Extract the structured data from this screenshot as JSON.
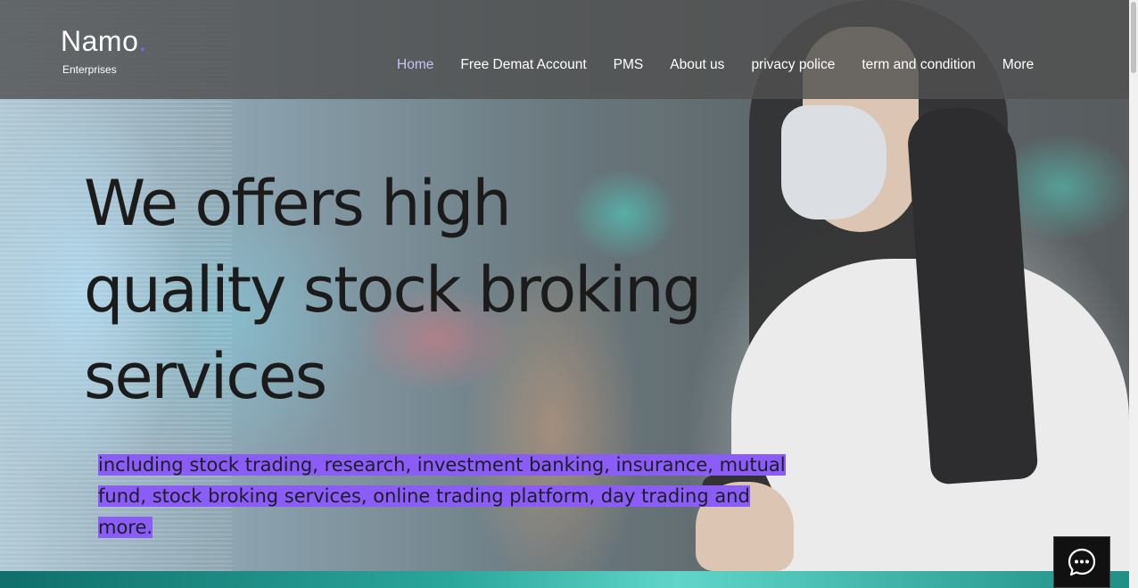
{
  "header": {
    "logo_name": "Namo",
    "logo_dot": ".",
    "logo_sub": "Enterprises"
  },
  "nav": {
    "items": [
      {
        "label": "Home",
        "active": true
      },
      {
        "label": "Free Demat Account",
        "active": false
      },
      {
        "label": "PMS",
        "active": false
      },
      {
        "label": "About us",
        "active": false
      },
      {
        "label": "privacy police",
        "active": false
      },
      {
        "label": "term and condition",
        "active": false
      },
      {
        "label": "More",
        "active": false
      }
    ]
  },
  "hero": {
    "headline_line1": "We offers high",
    "headline_line2": "quality stock broking",
    "headline_line3": "services",
    "subtext": "including stock trading, research, investment banking, insurance, mutual fund, stock broking services, online trading platform, day trading and more."
  },
  "chat": {
    "icon": "chat-bubble-icon"
  },
  "colors": {
    "accent": "#8b5cf6",
    "active_nav": "#c6c2f2",
    "header_bg": "#505050"
  }
}
